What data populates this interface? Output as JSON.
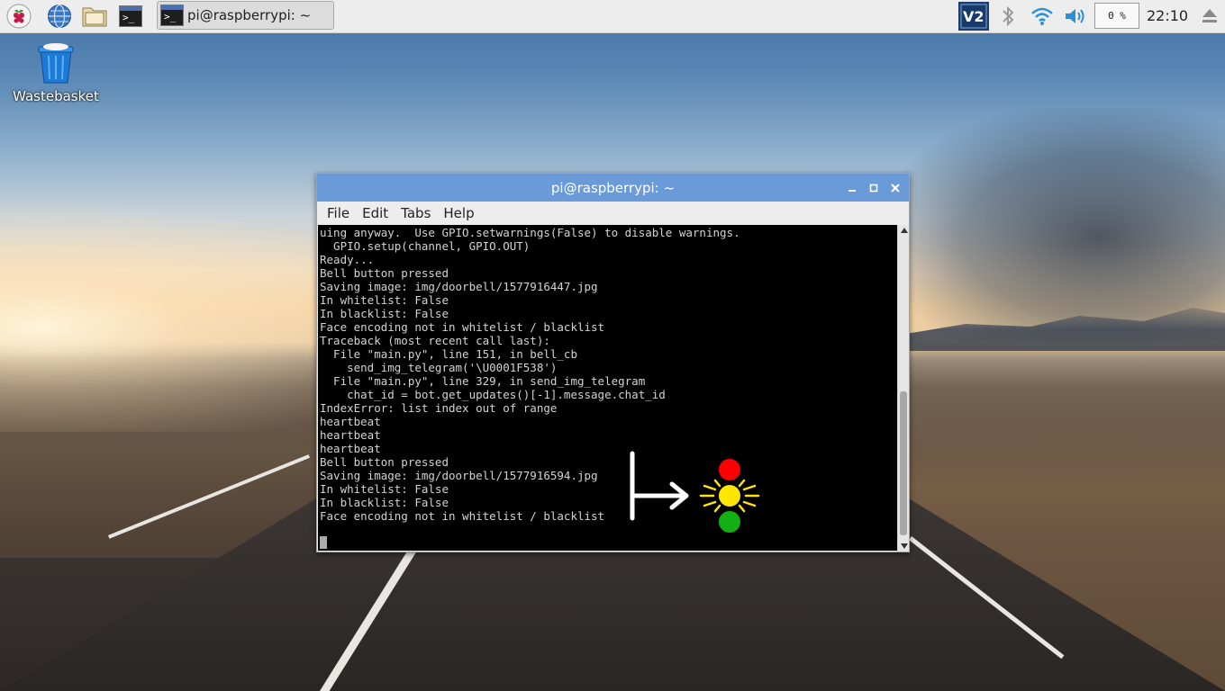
{
  "taskbar": {
    "task_title": "pi@raspberrypi: ~",
    "cpu_usage": "0 %",
    "clock": "22:10",
    "icons": [
      "raspberry-menu-icon",
      "web-browser-icon",
      "file-manager-icon",
      "terminal-launcher-icon",
      "vnc-icon",
      "bluetooth-icon",
      "wifi-icon",
      "volume-icon",
      "eject-icon"
    ]
  },
  "desktop": {
    "wastebasket_label": "Wastebasket"
  },
  "terminal": {
    "title": "pi@raspberrypi: ~",
    "menu": [
      "File",
      "Edit",
      "Tabs",
      "Help"
    ],
    "lines": [
      "uing anyway.  Use GPIO.setwarnings(False) to disable warnings.",
      "  GPIO.setup(channel, GPIO.OUT)",
      "Ready...",
      "Bell button pressed",
      "Saving image: img/doorbell/1577916447.jpg",
      "In whitelist: False",
      "In blacklist: False",
      "Face encoding not in whitelist / blacklist",
      "Traceback (most recent call last):",
      "  File \"main.py\", line 151, in bell_cb",
      "    send_img_telegram('\\U0001F538')",
      "  File \"main.py\", line 329, in send_img_telegram",
      "    chat_id = bot.get_updates()[-1].message.chat_id",
      "IndexError: list index out of range",
      "heartbeat",
      "heartbeat",
      "heartbeat",
      "Bell button pressed",
      "Saving image: img/doorbell/1577916594.jpg",
      "In whitelist: False",
      "In blacklist: False",
      "Face encoding not in whitelist / blacklist"
    ]
  },
  "overlay": {
    "traffic_light_colors": {
      "red": "#ff0000",
      "yellow": "#ffe600",
      "green": "#13b013"
    },
    "icons": [
      "arrow-icon",
      "traffic-light-icon"
    ]
  }
}
